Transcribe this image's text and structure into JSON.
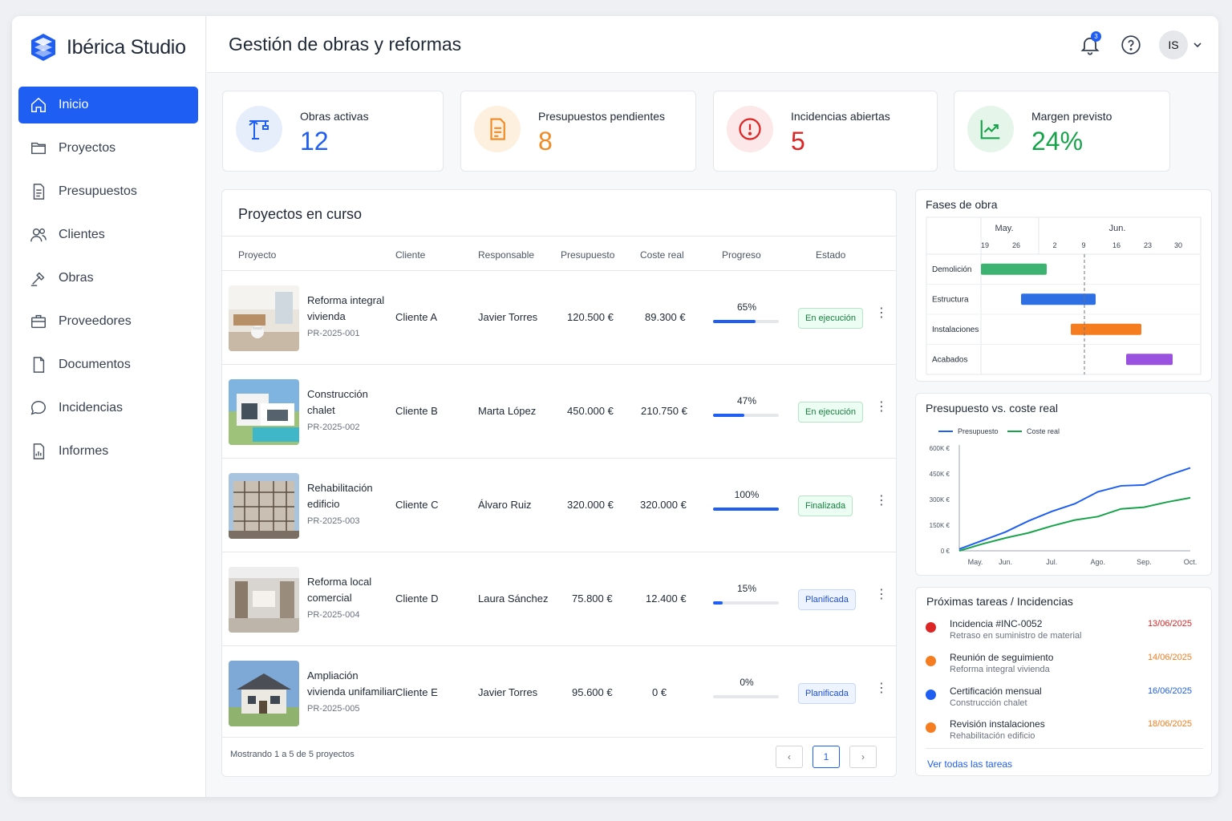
{
  "app": {
    "name": "Ibérica Studio"
  },
  "sidebar": {
    "items": [
      {
        "label": "Inicio",
        "icon": "home-icon"
      },
      {
        "label": "Proyectos",
        "icon": "folder-icon"
      },
      {
        "label": "Presupuestos",
        "icon": "document-icon"
      },
      {
        "label": "Clientes",
        "icon": "users-icon"
      },
      {
        "label": "Obras",
        "icon": "tools-icon"
      },
      {
        "label": "Proveedores",
        "icon": "briefcase-icon"
      },
      {
        "label": "Documentos",
        "icon": "file-icon"
      },
      {
        "label": "Incidencias",
        "icon": "chat-icon"
      },
      {
        "label": "Informes",
        "icon": "report-icon"
      }
    ]
  },
  "header": {
    "title": "Gestión de obras y reformas",
    "notifications": "3",
    "avatar": "IS"
  },
  "kpis": [
    {
      "label": "Obras activas",
      "value": "12",
      "color": "#1f5ef2",
      "icon": "crane-icon"
    },
    {
      "label": "Presupuestos pendientes",
      "value": "8",
      "color": "#f08a24",
      "icon": "invoice-icon"
    },
    {
      "label": "Incidencias abiertas",
      "value": "5",
      "color": "#dc2626",
      "icon": "alert-icon"
    },
    {
      "label": "Margen previsto",
      "value": "24%",
      "color": "#16a34a",
      "icon": "trend-up-icon"
    }
  ],
  "projects": {
    "title": "Proyectos en curso",
    "columns": [
      "Proyecto",
      "Cliente",
      "Responsable",
      "Presupuesto",
      "Coste real",
      "Progreso",
      "Estado"
    ],
    "rows": [
      {
        "name": "Reforma integral vivienda",
        "code": "PR-2025-001",
        "client": "Cliente A",
        "manager": "Javier Torres",
        "budget": "120.500 €",
        "cost": "89.300 €",
        "progress": 65,
        "progress_label": "65%",
        "status": "En ejecución",
        "status_kind": "green"
      },
      {
        "name": "Construcción chalet",
        "code": "PR-2025-002",
        "client": "Cliente B",
        "manager": "Marta López",
        "budget": "450.000 €",
        "cost": "210.750 €",
        "progress": 47,
        "progress_label": "47%",
        "status": "En ejecución",
        "status_kind": "green"
      },
      {
        "name": "Rehabilitación edificio",
        "code": "PR-2025-003",
        "client": "Cliente C",
        "manager": "Álvaro Ruiz",
        "budget": "320.000 €",
        "cost": "320.000 €",
        "progress": 100,
        "progress_label": "100%",
        "status": "Finalizada",
        "status_kind": "green"
      },
      {
        "name": "Reforma local comercial",
        "code": "PR-2025-004",
        "client": "Cliente D",
        "manager": "Laura Sánchez",
        "budget": "75.800 €",
        "cost": "12.400 €",
        "progress": 15,
        "progress_label": "15%",
        "status": "Planificada",
        "status_kind": "blue"
      },
      {
        "name": "Ampliación vivienda unifamiliar",
        "code": "PR-2025-005",
        "client": "Cliente E",
        "manager": "Javier Torres",
        "budget": "95.600 €",
        "cost": "0 €",
        "progress": 0,
        "progress_label": "0%",
        "status": "Planificada",
        "status_kind": "blue"
      }
    ],
    "footer": "Mostrando 1 a 5 de 5 proyectos",
    "page": "1"
  },
  "gantt": {
    "title": "Fases de obra",
    "months": [
      "May.",
      "Jun."
    ],
    "days": [
      "19",
      "26",
      "2",
      "9",
      "16",
      "23",
      "30"
    ],
    "phases": [
      {
        "name": "Demolición",
        "color": "#3cb371"
      },
      {
        "name": "Estructura",
        "color": "#2f6fe4"
      },
      {
        "name": "Instalaciones",
        "color": "#f57c1f"
      },
      {
        "name": "Acabados",
        "color": "#9b51e0"
      }
    ]
  },
  "chart_data": {
    "type": "line",
    "title": "Presupuesto vs. coste real",
    "categories": [
      "May.",
      "Jun.",
      "Jul.",
      "Ago.",
      "Sep.",
      "Oct."
    ],
    "x": [
      0,
      0.5,
      1,
      1.5,
      2,
      2.5,
      3,
      3.5,
      4,
      4.5,
      5
    ],
    "series": [
      {
        "name": "Presupuesto",
        "color": "#1f5ef2",
        "values": [
          10,
          60,
          110,
          175,
          230,
          275,
          345,
          380,
          385,
          440,
          485
        ]
      },
      {
        "name": "Coste real",
        "color": "#16a34a",
        "values": [
          0,
          40,
          75,
          105,
          145,
          180,
          200,
          245,
          255,
          285,
          310
        ]
      }
    ],
    "yticks": [
      "0 €",
      "150K €",
      "300K €",
      "450K €",
      "600K €"
    ],
    "ylim": [
      0,
      600
    ],
    "legend": "top-left",
    "grid": false
  },
  "tasks": {
    "title": "Próximas tareas / Incidencias",
    "items": [
      {
        "title": "Incidencia #INC-0052",
        "sub": "Retraso en suministro de material",
        "date": "13/06/2025",
        "color": "#dc2626"
      },
      {
        "title": "Reunión de seguimiento",
        "sub": "Reforma integral vivienda",
        "date": "14/06/2025",
        "color": "#f57c1f"
      },
      {
        "title": "Certificación mensual",
        "sub": "Construcción chalet",
        "date": "16/06/2025",
        "color": "#1f5ef2"
      },
      {
        "title": "Revisión instalaciones",
        "sub": "Rehabilitación edificio",
        "date": "18/06/2025",
        "color": "#f57c1f"
      }
    ],
    "link": "Ver todas las tareas"
  }
}
